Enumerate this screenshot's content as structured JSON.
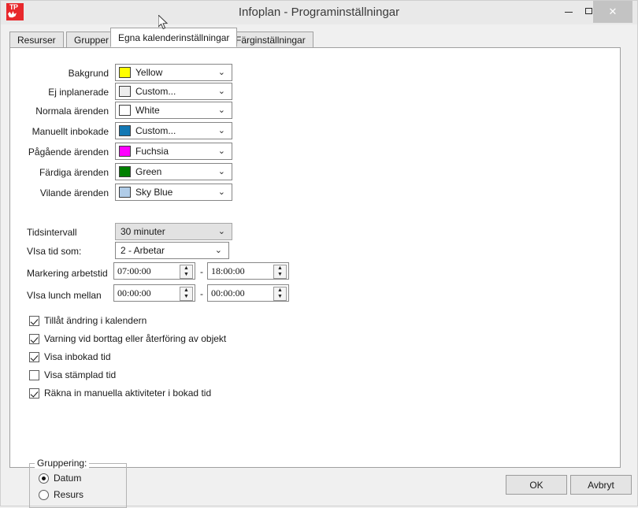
{
  "window": {
    "title": "Infoplan - Programinställningar",
    "app_icon": "tp-logo-icon",
    "minimize_label": "–",
    "maximize_label": "□",
    "close_label": "✕"
  },
  "tabs": [
    {
      "label": "Resurser",
      "active": false
    },
    {
      "label": "Grupper",
      "active": false
    },
    {
      "label": "Egna kalenderinställningar",
      "active": true
    },
    {
      "label": "Färginställningar",
      "active": false
    }
  ],
  "color_rows": [
    {
      "label": "Bakgrund",
      "value": "Yellow",
      "swatch": "#FFFF00"
    },
    {
      "label": "Ej inplanerade",
      "value": "Custom...",
      "swatch": "#EDEDED"
    },
    {
      "label": "Normala ärenden",
      "value": "White",
      "swatch": "#FFFFFF"
    },
    {
      "label": "Manuellt inbokade",
      "value": "Custom...",
      "swatch": "#1278B4"
    },
    {
      "label": "Pågående ärenden",
      "value": "Fuchsia",
      "swatch": "#FF00FF"
    },
    {
      "label": "Färdiga ärenden",
      "value": "Green",
      "swatch": "#008000"
    },
    {
      "label": "Vilande ärenden",
      "value": "Sky Blue",
      "swatch": "#B0CCE8"
    }
  ],
  "interval": {
    "label": "Tidsintervall",
    "value": "30 minuter"
  },
  "show_time_as": {
    "label": "VIsa tid som:",
    "value": "2 - Arbetar"
  },
  "work_time": {
    "label": "Markering arbetstid",
    "from": "07:00:00",
    "to": "18:00:00",
    "separator": "-"
  },
  "lunch_time": {
    "label": "VIsa lunch mellan",
    "from": "00:00:00",
    "to": "00:00:00",
    "separator": "-"
  },
  "checkboxes": [
    {
      "label": "Tillåt ändring i kalendern",
      "checked": true
    },
    {
      "label": "Varning vid borttag eller återföring av objekt",
      "checked": true
    },
    {
      "label": "Visa inbokad tid",
      "checked": true
    },
    {
      "label": "Visa stämplad tid",
      "checked": false
    },
    {
      "label": "Räkna in manuella aktiviteter i bokad tid",
      "checked": true
    }
  ],
  "grouping": {
    "legend": "Gruppering:",
    "options": [
      {
        "label": "Datum",
        "selected": true
      },
      {
        "label": "Resurs",
        "selected": false
      }
    ]
  },
  "footer": {
    "ok_label": "OK",
    "cancel_label": "Avbryt"
  },
  "icons": {
    "chevron_down": "⌄",
    "spin_up": "▲",
    "spin_down": "▼"
  }
}
